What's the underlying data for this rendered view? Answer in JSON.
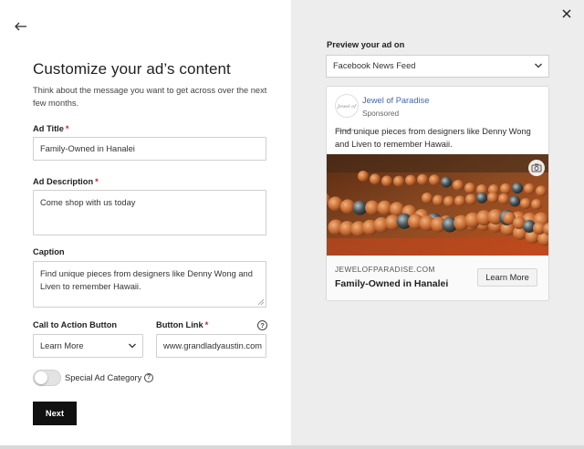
{
  "page": {
    "title": "Customize your ad’s content",
    "subtitle": "Think about the message you want to get across over the next few months."
  },
  "form": {
    "ad_title": {
      "label": "Ad Title",
      "required": "*",
      "value": "Family-Owned in Hanalei"
    },
    "ad_description": {
      "label": "Ad Description",
      "required": "*",
      "value": "Come shop with us today"
    },
    "caption": {
      "label": "Caption",
      "value": "Find unique pieces from designers like Denny Wong and Liven to remember Hawaii."
    },
    "cta_button": {
      "label": "Call to Action Button",
      "value": "Learn More"
    },
    "button_link": {
      "label": "Button Link",
      "required": "*",
      "value": "www.grandladyaustin.com"
    },
    "special_ad_category": {
      "label": "Special Ad Category",
      "enabled": false
    },
    "next_label": "Next"
  },
  "preview": {
    "label": "Preview your ad on",
    "placement": "Facebook News Feed",
    "card": {
      "brand": "Jewel of Paradise",
      "sponsored": "Sponsored",
      "text": "Find unique pieces from designers like Denny Wong and Liven to remember Hawaii.",
      "domain": "JEWELOFPARADISE.COM",
      "headline": "Family-Owned in Hanalei",
      "cta": "Learn More"
    }
  },
  "colors": {
    "accent": "#111111",
    "required": "#d4201f",
    "brand_link": "#4267b2",
    "preview_bg": "#ededed"
  },
  "icons": [
    "back-arrow-icon",
    "close-icon",
    "chevron-down-icon",
    "help-icon",
    "camera-icon",
    "resize-grip-icon"
  ]
}
